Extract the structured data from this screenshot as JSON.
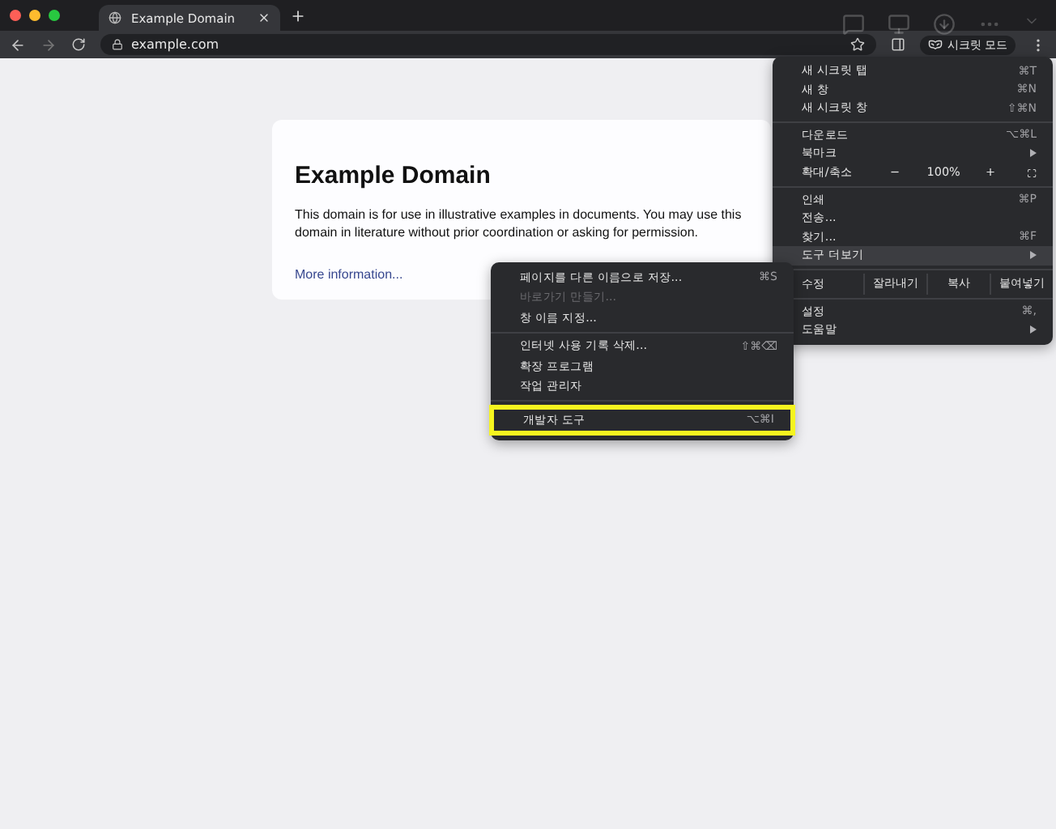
{
  "tabs": [
    {
      "title": "Example Domain",
      "selected": true
    }
  ],
  "address": "example.com",
  "profile_label": "시크릿 모드",
  "page": {
    "heading": "Example Domain",
    "paragraph": "This domain is for use in illustrative examples in documents. You may use this domain in literature without prior coordination or asking for permission.",
    "link": "More information..."
  },
  "main_menu": {
    "items": [
      {
        "kind": "item",
        "label": "새 시크릿 탭",
        "shortcut": "⌘T",
        "submenu": false,
        "highlighted": false
      },
      {
        "kind": "item",
        "label": "새 창",
        "shortcut": "⌘N",
        "submenu": false,
        "highlighted": false
      },
      {
        "kind": "item",
        "label": "새 시크릿 창",
        "shortcut": "⇧⌘N",
        "submenu": false,
        "highlighted": false
      },
      {
        "kind": "separator"
      },
      {
        "kind": "item",
        "label": "다운로드",
        "shortcut": "⌥⌘L",
        "submenu": false,
        "highlighted": false
      },
      {
        "kind": "item",
        "label": "북마크",
        "submenu": true,
        "highlighted": false
      },
      {
        "kind": "zoom",
        "label": "확대/축소",
        "minus": "−",
        "value": "100%",
        "plus": "+"
      },
      {
        "kind": "separator"
      },
      {
        "kind": "item",
        "label": "인쇄",
        "shortcut": "⌘P",
        "submenu": false,
        "highlighted": false
      },
      {
        "kind": "item",
        "label": "전송...",
        "submenu": false,
        "highlighted": false
      },
      {
        "kind": "item",
        "label": "찾기...",
        "shortcut": "⌘F",
        "submenu": false,
        "highlighted": false
      },
      {
        "kind": "item",
        "label": "도구 더보기",
        "submenu": true,
        "highlighted": true
      },
      {
        "kind": "separator"
      },
      {
        "kind": "edit",
        "label": "수정",
        "buttons": [
          "잘라내기",
          "복사",
          "붙여넣기"
        ]
      },
      {
        "kind": "separator"
      },
      {
        "kind": "item",
        "label": "설정",
        "shortcut": "⌘,",
        "submenu": false,
        "highlighted": false
      },
      {
        "kind": "item",
        "label": "도움말",
        "submenu": true,
        "highlighted": false
      }
    ]
  },
  "sub_menu": {
    "items": [
      {
        "kind": "item",
        "label": "페이지를 다른 이름으로 저장...",
        "shortcut": "⌘S",
        "disabled": false,
        "outlined": false
      },
      {
        "kind": "item",
        "label": "바로가기 만들기...",
        "disabled": true,
        "outlined": false
      },
      {
        "kind": "item",
        "label": "창 이름 지정...",
        "disabled": false,
        "outlined": false
      },
      {
        "kind": "separator"
      },
      {
        "kind": "item",
        "label": "인터넷 사용 기록 삭제...",
        "shortcut": "⇧⌘⌫",
        "disabled": false,
        "outlined": false
      },
      {
        "kind": "item",
        "label": "확장 프로그램",
        "disabled": false,
        "outlined": false
      },
      {
        "kind": "item",
        "label": "작업 관리자",
        "disabled": false,
        "outlined": false
      },
      {
        "kind": "separator"
      },
      {
        "kind": "item",
        "label": "개발자 도구",
        "shortcut": "⌥⌘I",
        "disabled": false,
        "outlined": true
      }
    ]
  }
}
